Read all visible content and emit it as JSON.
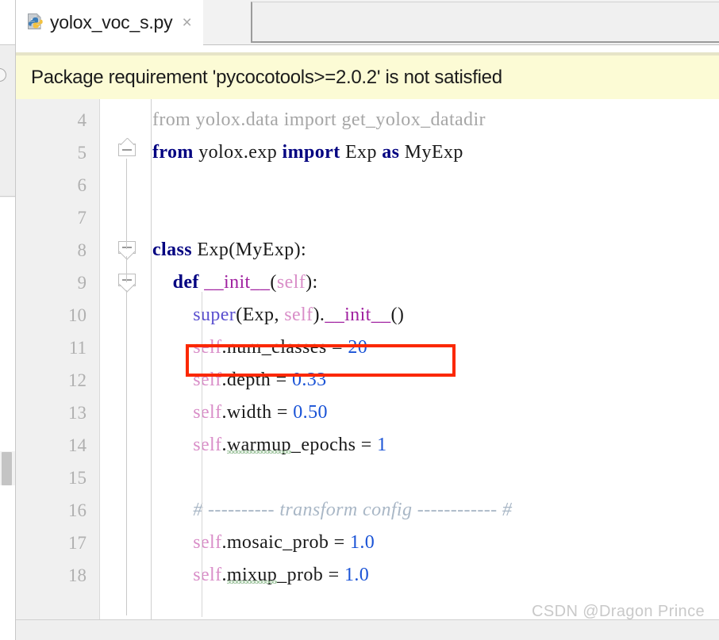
{
  "window": {
    "app": "PyCharm",
    "editor_theme": "light"
  },
  "tab": {
    "icon": "python-file-icon",
    "label": "yolox_voc_s.py",
    "close_label": "×"
  },
  "notification": {
    "icon": "warning-banner",
    "text": "Package requirement 'pycocotools>=2.0.2' is not satisfied",
    "background": "#fcfbd5"
  },
  "annotation": {
    "type": "red-rectangle-highlight",
    "target_line": 11,
    "color": "#fb2800"
  },
  "watermark": {
    "text": "CSDN @Dragon Prince"
  },
  "editor": {
    "first_visible_line": 4,
    "last_visible_line": 18,
    "line_numbers": [
      "4",
      "5",
      "6",
      "7",
      "8",
      "9",
      "10",
      "11",
      "12",
      "13",
      "14",
      "15",
      "16",
      "17",
      "18"
    ],
    "lines": [
      {
        "number": "4",
        "plain": "from yolox.data import get_yolox_datadir",
        "tokens": [
          {
            "t": "from ",
            "c": "muted-kw"
          },
          {
            "t": "yolox.data ",
            "c": "muted"
          },
          {
            "t": "import ",
            "c": "muted-kw"
          },
          {
            "t": "get_yolox_datadir",
            "c": "muted"
          }
        ]
      },
      {
        "number": "5",
        "plain": "from yolox.exp import Exp as MyExp",
        "tokens": [
          {
            "t": "from ",
            "c": "kw"
          },
          {
            "t": "yolox.exp ",
            "c": "ident"
          },
          {
            "t": "import ",
            "c": "kw"
          },
          {
            "t": "Exp ",
            "c": "ident"
          },
          {
            "t": "as ",
            "c": "kw"
          },
          {
            "t": "MyExp",
            "c": "ident"
          }
        ]
      },
      {
        "number": "6",
        "plain": "",
        "tokens": []
      },
      {
        "number": "7",
        "plain": "",
        "tokens": []
      },
      {
        "number": "8",
        "plain": "class Exp(MyExp):",
        "tokens": [
          {
            "t": "class ",
            "c": "kw"
          },
          {
            "t": "Exp(MyExp):",
            "c": "ident"
          }
        ]
      },
      {
        "number": "9",
        "plain": "    def __init__(self):",
        "tokens": [
          {
            "t": "    ",
            "c": "ident"
          },
          {
            "t": "def ",
            "c": "kw"
          },
          {
            "t": "__init__",
            "c": "dunder"
          },
          {
            "t": "(",
            "c": "ident"
          },
          {
            "t": "self",
            "c": "selfkw"
          },
          {
            "t": "):",
            "c": "ident"
          }
        ]
      },
      {
        "number": "10",
        "plain": "        super(Exp, self).__init__()",
        "tokens": [
          {
            "t": "        ",
            "c": "ident"
          },
          {
            "t": "super",
            "c": "builtin"
          },
          {
            "t": "(Exp, ",
            "c": "ident"
          },
          {
            "t": "self",
            "c": "selfkw"
          },
          {
            "t": ").",
            "c": "ident"
          },
          {
            "t": "__init__",
            "c": "dunder"
          },
          {
            "t": "()",
            "c": "ident"
          }
        ]
      },
      {
        "number": "11",
        "plain": "        self.num_classes = 20",
        "tokens": [
          {
            "t": "        ",
            "c": "ident"
          },
          {
            "t": "self",
            "c": "selfkw"
          },
          {
            "t": ".num_classes = ",
            "c": "ident"
          },
          {
            "t": "20",
            "c": "num"
          }
        ]
      },
      {
        "number": "12",
        "plain": "        self.depth = 0.33",
        "tokens": [
          {
            "t": "        ",
            "c": "ident"
          },
          {
            "t": "self",
            "c": "selfkw"
          },
          {
            "t": ".depth = ",
            "c": "ident"
          },
          {
            "t": "0.33",
            "c": "num"
          }
        ]
      },
      {
        "number": "13",
        "plain": "        self.width = 0.50",
        "tokens": [
          {
            "t": "        ",
            "c": "ident"
          },
          {
            "t": "self",
            "c": "selfkw"
          },
          {
            "t": ".width = ",
            "c": "ident"
          },
          {
            "t": "0.50",
            "c": "num"
          }
        ]
      },
      {
        "number": "14",
        "plain": "        self.warmup_epochs = 1",
        "spellcheck": "warmup",
        "tokens": [
          {
            "t": "        ",
            "c": "ident"
          },
          {
            "t": "self",
            "c": "selfkw"
          },
          {
            "t": ".",
            "c": "ident"
          },
          {
            "t": "warmup",
            "c": "ident-wavy"
          },
          {
            "t": "_epochs = ",
            "c": "ident"
          },
          {
            "t": "1",
            "c": "num"
          }
        ]
      },
      {
        "number": "15",
        "plain": "",
        "tokens": []
      },
      {
        "number": "16",
        "plain": "        # ---------- transform config ------------ #",
        "tokens": [
          {
            "t": "        ",
            "c": "ident"
          },
          {
            "t": "# ---------- transform config ------------ #",
            "c": "comment"
          }
        ]
      },
      {
        "number": "17",
        "plain": "        self.mosaic_prob = 1.0",
        "tokens": [
          {
            "t": "        ",
            "c": "ident"
          },
          {
            "t": "self",
            "c": "selfkw"
          },
          {
            "t": ".mosaic_prob = ",
            "c": "ident"
          },
          {
            "t": "1.0",
            "c": "num"
          }
        ]
      },
      {
        "number": "18",
        "plain": "        self.mixup_prob = 1.0",
        "spellcheck": "mixup",
        "tokens": [
          {
            "t": "        ",
            "c": "ident"
          },
          {
            "t": "self",
            "c": "selfkw"
          },
          {
            "t": ".",
            "c": "ident"
          },
          {
            "t": "mixup",
            "c": "ident-wavy"
          },
          {
            "t": "_prob = ",
            "c": "ident"
          },
          {
            "t": "1.0",
            "c": "num"
          }
        ]
      }
    ],
    "fold_markers": [
      {
        "line": "5",
        "state": "expanded",
        "glyph": "minus"
      },
      {
        "line": "8",
        "state": "expanded",
        "glyph": "minus"
      },
      {
        "line": "9",
        "state": "expanded",
        "glyph": "minus"
      }
    ]
  }
}
